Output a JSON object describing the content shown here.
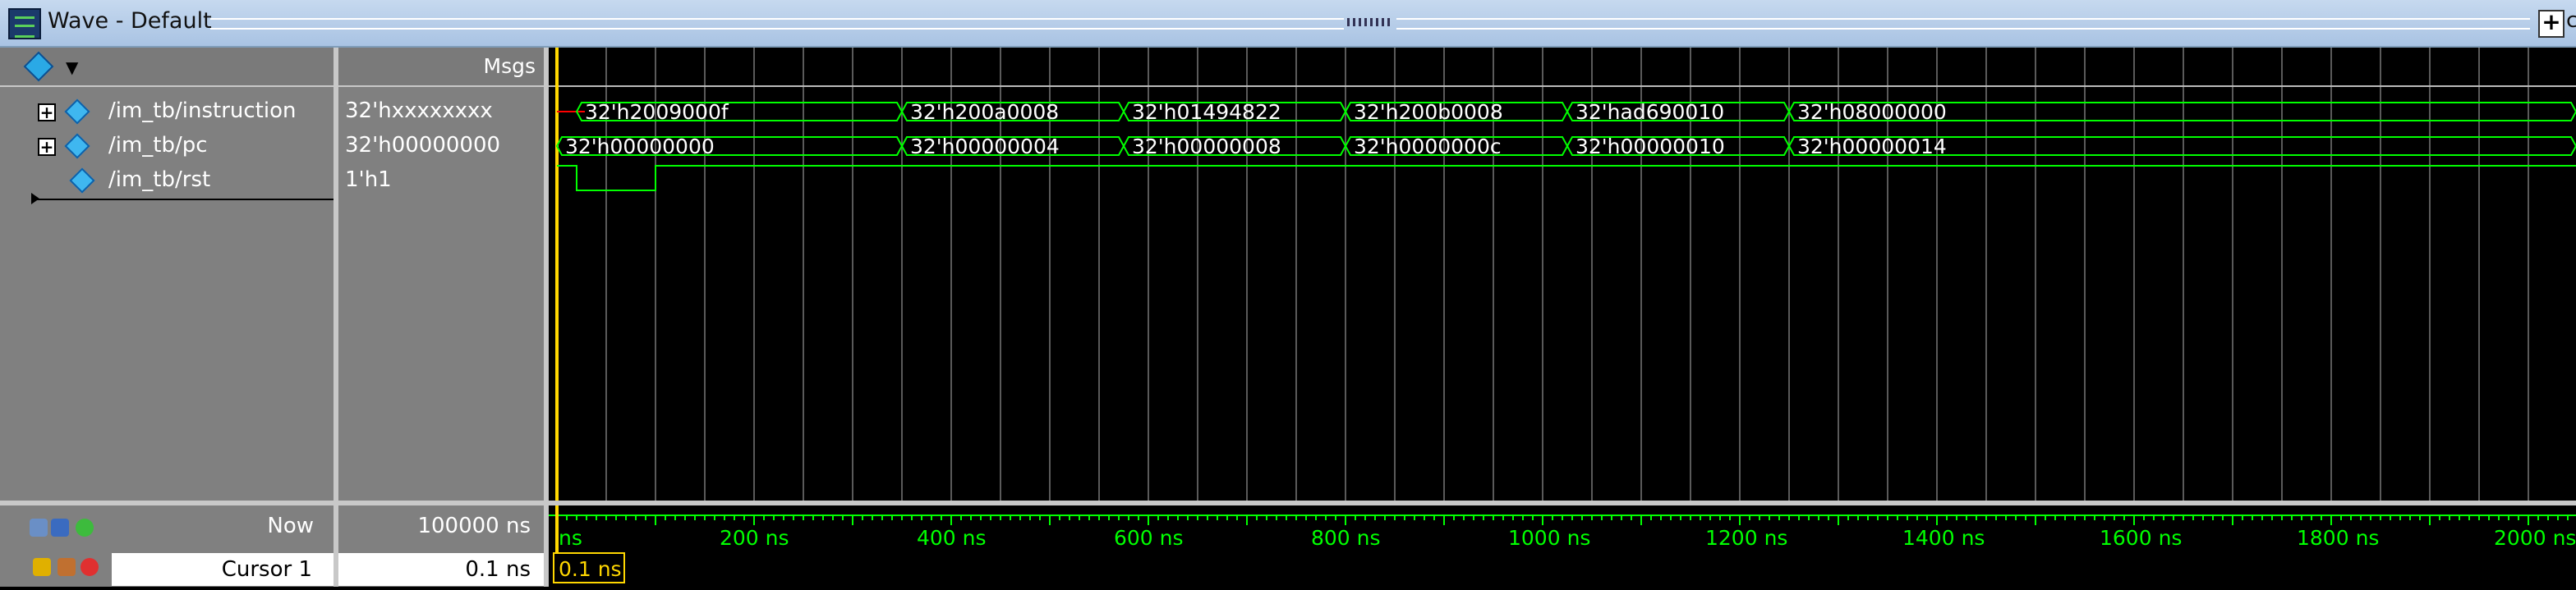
{
  "window": {
    "title": "Wave - Default",
    "title_clip": "c"
  },
  "header": {
    "msgs_label": "Msgs"
  },
  "signals": [
    {
      "name": "/im_tb/instruction",
      "value": "32'hxxxxxxxx",
      "expandable": true
    },
    {
      "name": "/im_tb/pc",
      "value": "32'h00000000",
      "expandable": true
    },
    {
      "name": "/im_tb/rst",
      "value": "1'h1",
      "expandable": false
    }
  ],
  "waves": {
    "instruction_values": [
      "32'h2009000f",
      "32'h200a0008",
      "32'h01494822",
      "32'h200b0008",
      "32'had690010",
      "32'h08000000"
    ],
    "pc_values": [
      "32'h00000000",
      "32'h00000004",
      "32'h00000008",
      "32'h0000000c",
      "32'h00000010",
      "32'h00000014"
    ]
  },
  "timeline": {
    "ticks": [
      "ns",
      "200 ns",
      "400 ns",
      "600 ns",
      "800 ns",
      "1000 ns",
      "1200 ns",
      "1400 ns",
      "1600 ns",
      "1800 ns",
      "2000 ns"
    ],
    "cursor_time": "0.1 ns"
  },
  "status": {
    "now_label": "Now",
    "now_value": "100000 ns",
    "cursor_label": "Cursor 1",
    "cursor_value": "0.1 ns"
  },
  "colors": {
    "wave": "#00ff00",
    "grid": "#5a5a5a",
    "cursor": "#ffd700",
    "undefined": "#ff0000",
    "timeline_text": "#00ff00"
  }
}
